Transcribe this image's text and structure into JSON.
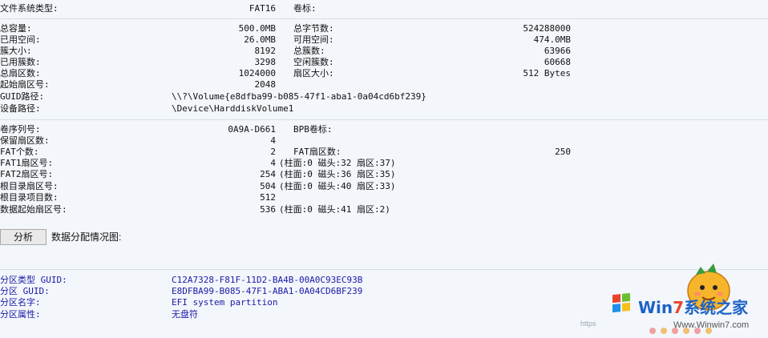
{
  "filesystem": {
    "label": "文件系统类型:",
    "value": "FAT16",
    "volume_label_label": "卷标:"
  },
  "capacity": {
    "left": [
      {
        "label": "总容量:",
        "value": "500.0MB"
      },
      {
        "label": "已用空间:",
        "value": "26.0MB"
      },
      {
        "label": "簇大小:",
        "value": "8192"
      },
      {
        "label": "已用簇数:",
        "value": "3298"
      },
      {
        "label": "总扇区数:",
        "value": "1024000"
      },
      {
        "label": "起始扇区号:",
        "value": "2048"
      }
    ],
    "right": [
      {
        "label": "总字节数:",
        "value": "524288000"
      },
      {
        "label": "可用空间:",
        "value": "474.0MB"
      },
      {
        "label": "总簇数:",
        "value": "63966"
      },
      {
        "label": "空闲簇数:",
        "value": "60668"
      },
      {
        "label": "扇区大小:",
        "value": "512 Bytes"
      }
    ],
    "guid_path_label": "GUID路径:",
    "guid_path_value": "\\\\?\\Volume{e8dfba99-b085-47f1-aba1-0a04cd6bf239}",
    "device_path_label": "设备路径:",
    "device_path_value": "\\Device\\HarddiskVolume1"
  },
  "fat": {
    "serial_label": "卷序列号:",
    "serial_value": "0A9A-D661",
    "bpb_label": "BPB卷标:",
    "reserved_label": "保留扇区数:",
    "reserved_value": "4",
    "fat_count_label": "FAT个数:",
    "fat_count_value": "2",
    "fat_sectors_label": "FAT扇区数:",
    "fat_sectors_value": "250",
    "rows": [
      {
        "label": "FAT1扇区号:",
        "value": "4",
        "chs": "(柱面:0 磁头:32 扇区:37)"
      },
      {
        "label": "FAT2扇区号:",
        "value": "254",
        "chs": "(柱面:0 磁头:36 扇区:35)"
      },
      {
        "label": "根目录扇区号:",
        "value": "504",
        "chs": "(柱面:0 磁头:40 扇区:33)"
      },
      {
        "label": "根目录项目数:",
        "value": "512",
        "chs": ""
      },
      {
        "label": "数据起始扇区号:",
        "value": "536",
        "chs": "(柱面:0 磁头:41 扇区:2)"
      }
    ]
  },
  "analyze": {
    "button_label": "分析",
    "caption": "数据分配情况图:"
  },
  "partition": {
    "rows": [
      {
        "label": "分区类型 GUID:",
        "value": "C12A7328-F81F-11D2-BA4B-00A0C93EC93B"
      },
      {
        "label": "分区 GUID:",
        "value": "E8DFBA99-B085-47F1-ABA1-0A04CD6BF239"
      },
      {
        "label": "分区名字:",
        "value": "EFI system partition"
      },
      {
        "label": "分区属性:",
        "value": "无盘符"
      }
    ]
  },
  "watermark": {
    "brand_prefix": "Win",
    "brand_digit": "7",
    "brand_suffix": "系统之家",
    "url": "Www.Winwin7.com",
    "small": "https"
  },
  "colors": {
    "background": "#f3f6fb",
    "value_blue": "#1a1aa6",
    "separator": "#d9dee6"
  }
}
